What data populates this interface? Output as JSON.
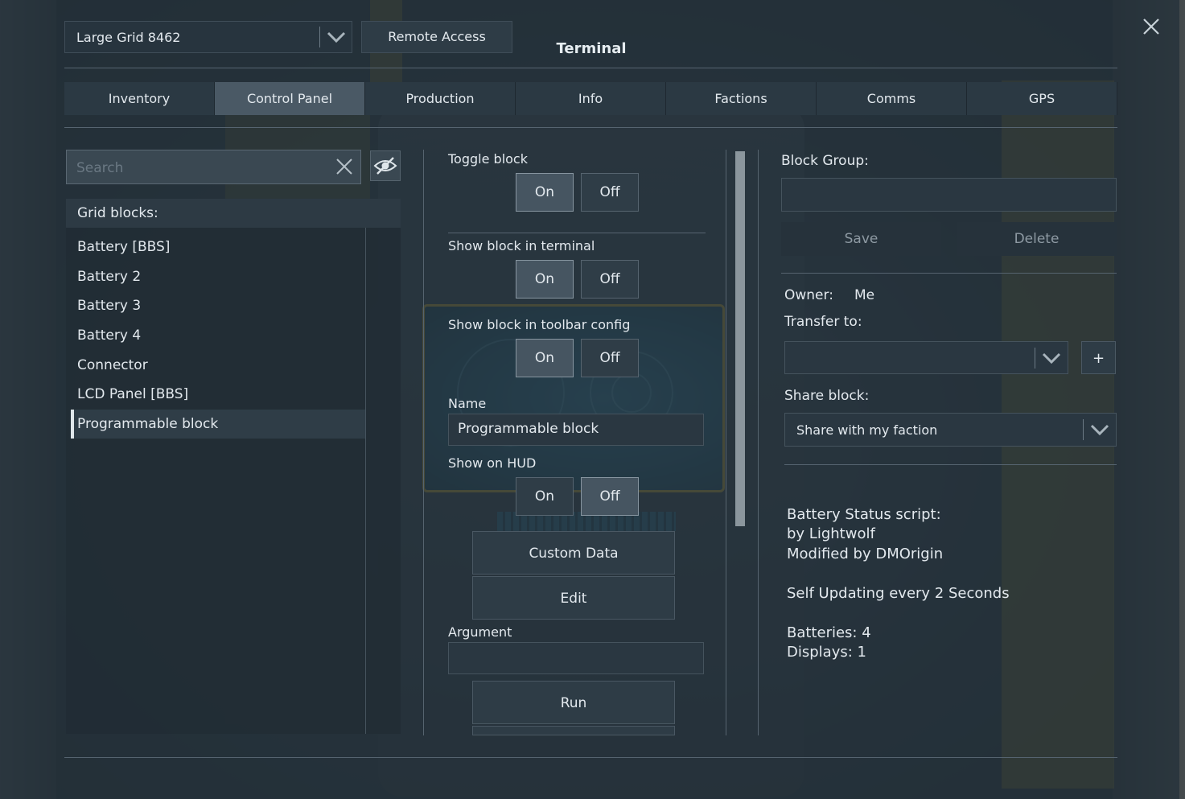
{
  "window": {
    "title": "Terminal"
  },
  "header": {
    "grid_select_value": "Large Grid 8462",
    "remote_access_label": "Remote Access"
  },
  "tabs": [
    {
      "label": "Inventory",
      "active": false
    },
    {
      "label": "Control Panel",
      "active": true
    },
    {
      "label": "Production",
      "active": false
    },
    {
      "label": "Info",
      "active": false
    },
    {
      "label": "Factions",
      "active": false
    },
    {
      "label": "Comms",
      "active": false
    },
    {
      "label": "GPS",
      "active": false
    }
  ],
  "left": {
    "search_placeholder": "Search",
    "header": "Grid blocks:",
    "items": [
      {
        "label": "Battery [BBS]",
        "selected": false
      },
      {
        "label": "Battery 2",
        "selected": false
      },
      {
        "label": "Battery 3",
        "selected": false
      },
      {
        "label": "Battery 4",
        "selected": false
      },
      {
        "label": "Connector",
        "selected": false
      },
      {
        "label": "LCD Panel [BBS]",
        "selected": false
      },
      {
        "label": "Programmable block",
        "selected": true
      }
    ]
  },
  "middle": {
    "on_label": "On",
    "off_label": "Off",
    "toggle_block_label": "Toggle block",
    "toggle_block_state": "On",
    "show_in_terminal_label": "Show block in terminal",
    "show_in_terminal_state": "On",
    "show_in_toolbar_label": "Show block in toolbar config",
    "show_in_toolbar_state": "On",
    "name_label": "Name",
    "name_value": "Programmable block",
    "show_on_hud_label": "Show on HUD",
    "show_on_hud_state": "Off",
    "custom_data_label": "Custom Data",
    "edit_label": "Edit",
    "argument_label": "Argument",
    "argument_value": "",
    "run_label": "Run"
  },
  "right": {
    "block_group_label": "Block Group:",
    "block_group_value": "",
    "save_label": "Save",
    "delete_label": "Delete",
    "owner_label": "Owner:",
    "owner_value": "Me",
    "transfer_label": "Transfer to:",
    "transfer_value": "",
    "plus_label": "+",
    "share_label": "Share block:",
    "share_value": "Share with my faction",
    "info_lines": [
      "Battery Status script:",
      "by Lightwolf",
      "Modified by DMOrigin",
      "Self Updating every 2 Seconds",
      "Batteries: 4",
      "Displays: 1"
    ]
  },
  "colors": {
    "panel": "#26323b",
    "selected_tab": "#4a5965",
    "screen_frame": "#c6a630"
  }
}
